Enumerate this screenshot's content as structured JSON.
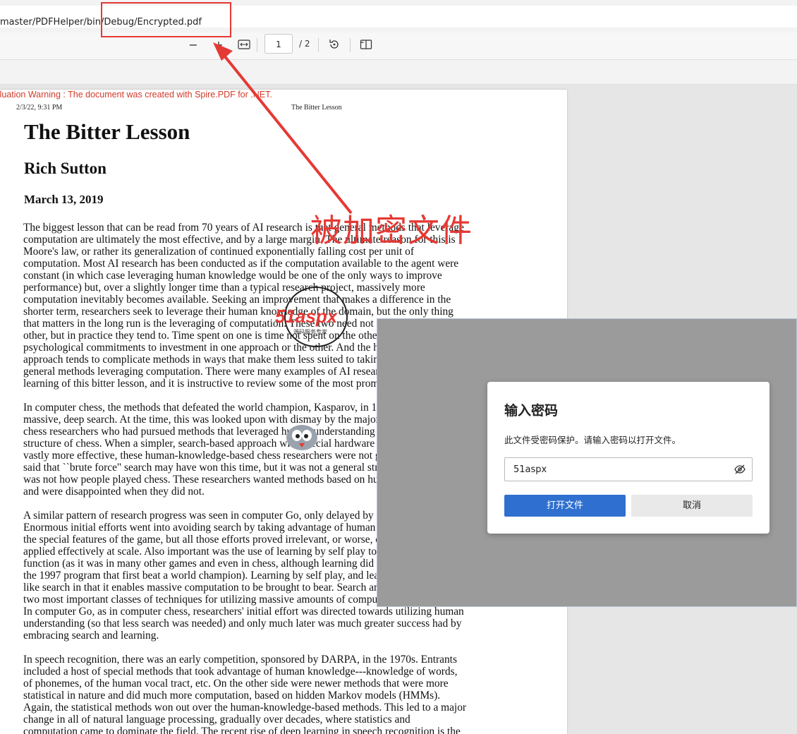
{
  "address_bar": {
    "url": "master/PDFHelper/bin/Debug/Encrypted.pdf"
  },
  "toolbar": {
    "zoom_out": "−",
    "zoom_in": "+",
    "page_current": "1",
    "page_total": "/ 2"
  },
  "pdf": {
    "eval_warning": "Evaluation Warning : The document was created with Spire.PDF for .NET.",
    "header_date": "2/3/22, 9:31 PM",
    "header_title": "The Bitter Lesson",
    "title": "The Bitter Lesson",
    "author": "Rich Sutton",
    "date": "March 13, 2019",
    "paragraphs": [
      [
        "The biggest lesson that can be read from 70 years of AI research is that general methods that leverage",
        "computation are ultimately the most effective, and by a large margin. The ultimate reason for this is",
        "Moore's law, or rather its generalization of continued exponentially falling cost per unit of",
        "computation. Most AI research has been conducted as if the computation available to the agent were",
        "constant (in which case leveraging human knowledge would be one of the only ways to improve",
        "performance) but, over a slightly longer time than a typical research project, massively more",
        "computation inevitably becomes available. Seeking an improvement that makes a difference in the",
        "shorter term, researchers seek to leverage their human knowledge of the domain, but the only thing",
        "that matters in the long run is the leveraging of computation. These two need not run counter to each",
        "other, but in practice they tend to. Time spent on one is time not spent on the other. There are",
        "psychological commitments to investment in one approach or the other. And the human-knowledge",
        "approach tends to complicate methods in ways that make them less suited to taking advantage of",
        "general methods leveraging computation.  There were many examples of AI researchers' belated",
        "learning of this bitter lesson, and it is instructive to review some of the most prominent."
      ],
      [
        "In computer chess, the methods that defeated the world champion, Kasparov, in 1997, were based on",
        "massive, deep search. At the time, this was looked upon with dismay by the majority of computer-",
        "chess researchers who had pursued methods that leveraged human understanding of the special",
        "structure of chess. When a simpler, search-based approach with special hardware and software proved",
        "vastly more effective, these human-knowledge-based chess researchers were not good losers. They",
        "said that ``brute force\" search may have won this time, but it was not a general strategy, and anyway it",
        "was not how people played chess. These researchers wanted methods based on human input to win",
        "and were disappointed when they did not."
      ],
      [
        "A similar pattern of research progress was seen in computer Go, only delayed by a further 20 years.",
        "Enormous initial efforts went into avoiding search by taking advantage of human knowledge, or of",
        "the special features of the game, but all those efforts proved irrelevant, or worse, once search was",
        "applied effectively at scale. Also important was the use of learning by self play to learn a value",
        "function (as it was in many other games and even in chess, although learning did not play a big role in",
        "the 1997 program that first beat a world champion). Learning by self play, and learning in general, is",
        "like search in that it enables massive computation to be brought to bear. Search and learning are the",
        "two most important classes of techniques for utilizing massive amounts of computation in AI research.",
        "In computer Go, as in computer chess, researchers' initial effort was directed towards utilizing human",
        "understanding (so that less search was needed) and only much later was much greater success had by",
        "embracing search and learning."
      ],
      [
        "In speech recognition, there was an early competition, sponsored by DARPA, in the 1970s. Entrants",
        "included a host of special methods that took advantage of human knowledge---knowledge of words,",
        "of phonemes, of the human vocal tract, etc. On the other side were newer methods that were more",
        "statistical in nature and did much more computation, based on hidden Markov models (HMMs).",
        "Again, the statistical methods won out over the human-knowledge-based methods. This led to a major",
        "change in all of natural language processing, gradually over decades, where statistics and",
        "computation came to dominate the field. The recent rise of deep learning in speech recognition is the"
      ]
    ]
  },
  "dialog": {
    "title": "输入密码",
    "message": "此文件受密码保护。请输入密码以打开文件。",
    "password_value": "51aspx",
    "open_button": "打开文件",
    "cancel_button": "取消"
  },
  "annotation": {
    "label": "被加密文件",
    "color": "#e53935"
  },
  "watermark": {
    "text": "51aspx",
    "subtext": "源码服务专家"
  }
}
